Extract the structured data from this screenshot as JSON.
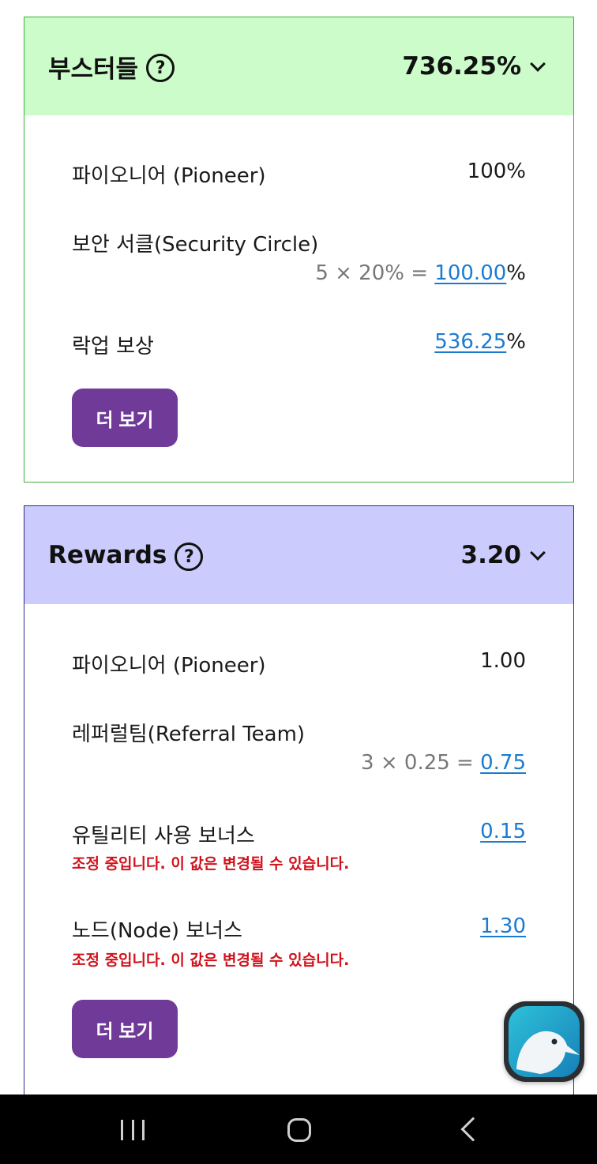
{
  "boosters": {
    "title": "부스터들",
    "total": "736.25%",
    "rows": [
      {
        "label": "파이오니어 (Pioneer)",
        "value": "100%"
      },
      {
        "label": "보안 서클(Security Circle)",
        "formula": "5 × 20% = ",
        "link": "100.00",
        "suffix": "%"
      },
      {
        "label": "락업 보상",
        "link": "536.25",
        "suffix": "%"
      }
    ],
    "more_label": "더 보기"
  },
  "rewards": {
    "title": "Rewards",
    "total": "3.20",
    "rows": [
      {
        "label": "파이오니어 (Pioneer)",
        "value": "1.00"
      },
      {
        "label": "레퍼럴팀(Referral Team)",
        "formula": "3 × 0.25 = ",
        "link": "0.75"
      },
      {
        "label": "유틸리티 사용 보너스",
        "link": "0.15",
        "warning": "조정 중입니다. 이 값은 변경될 수 있습니다."
      },
      {
        "label": "노드(Node) 보너스",
        "link": "1.30",
        "warning": "조정 중입니다. 이 값은 변경될 수 있습니다."
      }
    ],
    "more_label": "더 보기"
  },
  "help_glyph": "?",
  "colors": {
    "boosters_header": "#ccfcca",
    "boosters_border": "#3fae3f",
    "rewards_header": "#cccbfd",
    "rewards_border": "#2b2c8a",
    "button": "#6f3a98",
    "link": "#1b7bd2",
    "warning": "#d0121b"
  },
  "icons": {
    "help": "help-circle-icon",
    "expand": "chevron-down-icon",
    "fab": "kiwi-browser-icon",
    "nav_recents": "recent-apps-icon",
    "nav_home": "home-icon",
    "nav_back": "back-icon"
  }
}
